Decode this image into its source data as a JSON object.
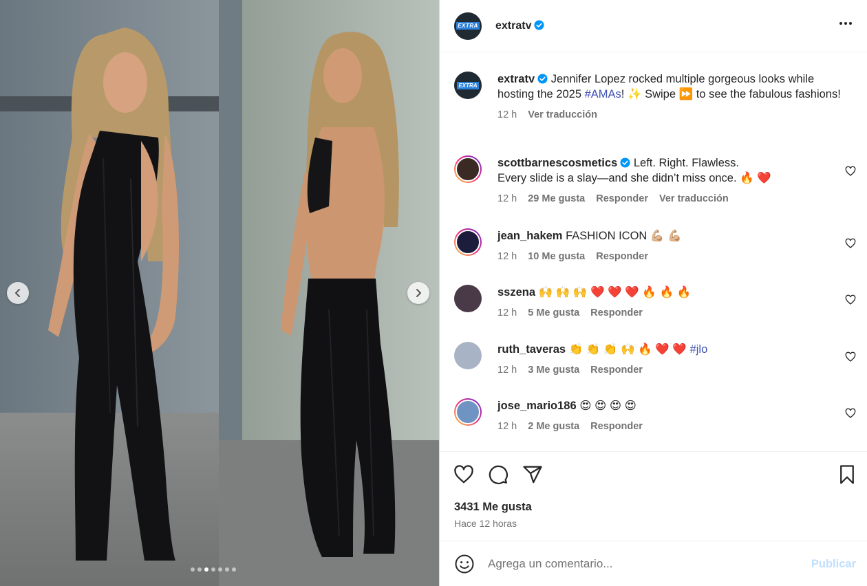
{
  "post": {
    "author": "extratv",
    "brand_logo_text": "EXTRA",
    "more_icon": "more-horizontal-icon"
  },
  "media": {
    "dots_total": 7,
    "active_dot": 3,
    "prev_icon": "chevron-left-icon",
    "next_icon": "chevron-right-icon"
  },
  "caption": {
    "username": "extratv",
    "text_1": "Jennifer Lopez rocked multiple gorgeous looks while hosting the 2025 ",
    "hashtag": "#AMAs",
    "text_2": "! ✨ Swipe ⏩ to see the fabulous fashions!",
    "time": "12 h",
    "translate": "Ver traducción"
  },
  "comments": [
    {
      "username": "scottbarnescosmetics",
      "verified": true,
      "text": "Left. Right. Flawless.\nEvery slide is a slay—and she didn’t miss once. 🔥 ❤️",
      "time": "12 h",
      "likes": "29 Me gusta",
      "reply": "Responder",
      "translate": "Ver traducción"
    },
    {
      "username": "jean_hakem",
      "text": "FASHION ICON 💪🏼 💪🏼",
      "time": "12 h",
      "likes": "10 Me gusta",
      "reply": "Responder"
    },
    {
      "username": "sszena",
      "text": "🙌 🙌 🙌 ❤️ ❤️ ❤️ 🔥 🔥 🔥",
      "time": "12 h",
      "likes": "5 Me gusta",
      "reply": "Responder"
    },
    {
      "username": "ruth_taveras",
      "text": "👏 👏 👏 🙌 🔥 ❤️ ❤️ ",
      "hashtag": "#jlo",
      "time": "12 h",
      "likes": "3 Me gusta",
      "reply": "Responder"
    },
    {
      "username": "jose_mario186",
      "text": "😍 😍 😍 😍",
      "time": "12 h",
      "likes": "2 Me gusta",
      "reply": "Responder"
    }
  ],
  "footer": {
    "likes": "3431 Me gusta",
    "posted": "Hace 12 horas",
    "comment_placeholder": "Agrega un comentario...",
    "publish": "Publicar"
  },
  "colors": {
    "accent": "#0095f6",
    "hashtag": "#4051b5",
    "secondary_text": "#737373",
    "verified": "#0095f6"
  }
}
